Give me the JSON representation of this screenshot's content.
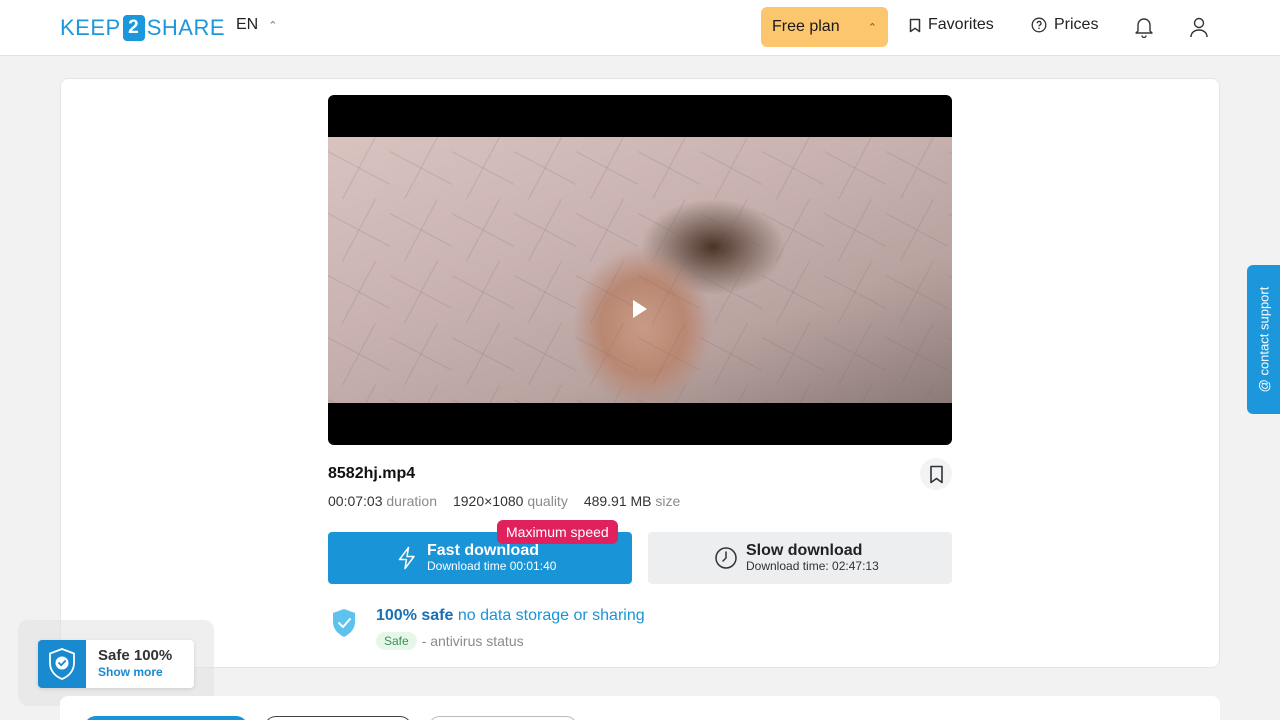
{
  "header": {
    "logo_left": "KEEP",
    "logo_num": "2",
    "logo_right": "SHARE",
    "language": "EN",
    "plan_label": "Free plan",
    "favorites_label": "Favorites",
    "prices_label": "Prices"
  },
  "file": {
    "name": "8582hj.mp4",
    "duration_value": "00:07:03",
    "duration_label": "duration",
    "quality_value": "1920×1080",
    "quality_label": "quality",
    "size_value": "489.91 MB",
    "size_label": "size"
  },
  "downloads": {
    "badge": "Maximum speed",
    "fast_title": "Fast download",
    "fast_sub": "Download time 00:01:40",
    "slow_title": "Slow download",
    "slow_sub": "Download time: 02:47:13"
  },
  "safety": {
    "bold": "100% safe",
    "rest": " no data storage or sharing",
    "badge": "Safe",
    "status": "- antivirus status"
  },
  "contact_label": "@ contact support",
  "widget": {
    "title": "Safe 100%",
    "link": "Show more"
  },
  "colors": {
    "brand": "#1d97dc",
    "plan": "#fbc66e",
    "badge": "#e0215e"
  }
}
